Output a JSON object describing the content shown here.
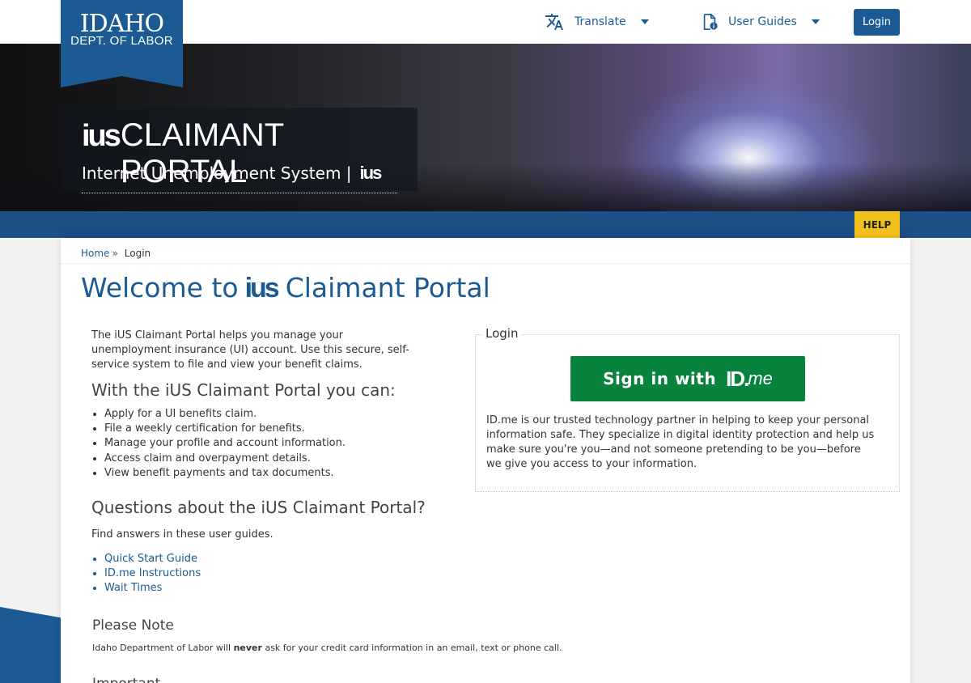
{
  "header": {
    "logo_line1": "IDAHO",
    "logo_line2": "DEPT. OF LABOR",
    "translate_label": "Translate",
    "user_guides_label": "User Guides",
    "login_label": "Login"
  },
  "hero": {
    "logo_mark": "ius",
    "title": "CLAIMANT PORTAL",
    "subtitle": "Internet Unemployment System |",
    "subtitle_mark": "ius"
  },
  "help_label": "HELP",
  "breadcrumb": {
    "home": "Home",
    "separator": "»",
    "current": "Login"
  },
  "main": {
    "welcome_prefix": "Welcome to",
    "welcome_mark": "ius",
    "welcome_suffix": "Claimant Portal",
    "intro": "The iUS Claimant Portal helps you manage your unemployment insurance (UI) account. Use this secure, self-service system to file and view your benefit claims.",
    "can_heading": "With the iUS Claimant Portal you can:",
    "can_items": [
      "Apply for a UI benefits claim.",
      "File a weekly certification for benefits.",
      "Manage your profile and account information.",
      "Access claim and overpayment details.",
      "View benefit payments and tax documents."
    ],
    "questions_heading": "Questions about the iUS Claimant Portal?",
    "find_text": "Find answers in these user guides.",
    "guide_links": [
      "Quick Start Guide",
      "ID.me Instructions",
      "Wait Times"
    ],
    "note_heading": "Please Note",
    "note_before": "Idaho Department of Labor will ",
    "note_strong": "never",
    "note_after": " ask for your credit card information in an email, text or phone call.",
    "important_heading": "Important"
  },
  "login_panel": {
    "legend": "Login",
    "button_prefix": "Sign in with",
    "button_brand_id": "ID.",
    "button_brand_me": "me",
    "description": "ID.me is our trusted technology partner in helping to keep your personal information safe. They specialize in digital identity protection and help us make sure you're you—and not someone pretending to be you—before we give you access to your information."
  },
  "colors": {
    "brand_blue": "#1b5a92",
    "help_yellow": "#f2c01d",
    "idme_green": "#08833d"
  }
}
